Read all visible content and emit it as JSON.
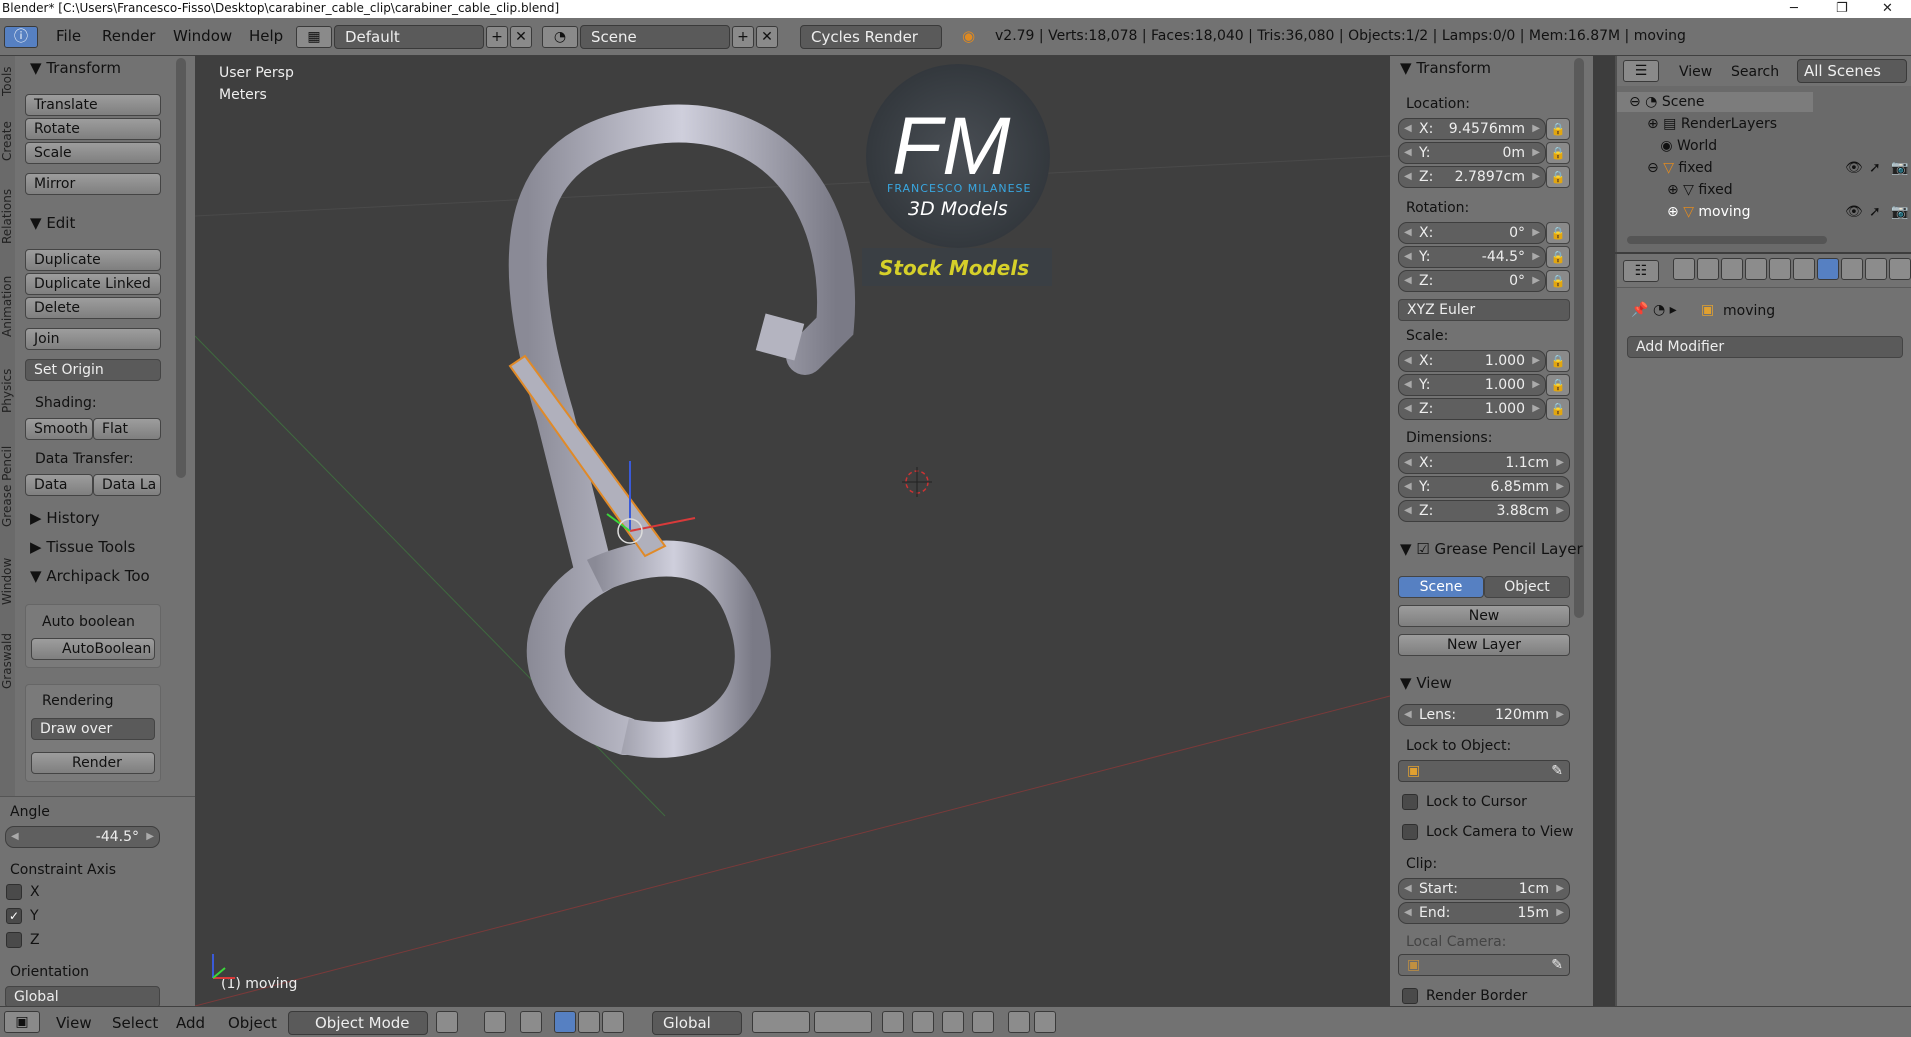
{
  "window": {
    "title": "Blender* [C:\\Users\\Francesco-Fisso\\Desktop\\carabiner_cable_clip\\carabiner_cable_clip.blend]"
  },
  "menubar": {
    "items": [
      "File",
      "Render",
      "Window",
      "Help"
    ],
    "screen_layout": "Default",
    "scene": "Scene",
    "render_engine": "Cycles Render",
    "stats": "v2.79 | Verts:18,078 | Faces:18,040 | Tris:36,080 | Objects:1/2 | Lamps:0/0 | Mem:16.87M | moving"
  },
  "tool_tabs": [
    "Tools",
    "Create",
    "Relations",
    "Animation",
    "Physics",
    "Grease Pencil",
    "Window",
    "Graswald"
  ],
  "tools": {
    "transform_title": "Transform",
    "translate": "Translate",
    "rotate": "Rotate",
    "scale": "Scale",
    "mirror": "Mirror",
    "edit_title": "Edit",
    "duplicate": "Duplicate",
    "duplicate_linked": "Duplicate Linked",
    "delete": "Delete",
    "join": "Join",
    "set_origin": "Set Origin",
    "shading_label": "Shading:",
    "smooth": "Smooth",
    "flat": "Flat",
    "data_transfer_label": "Data Transfer:",
    "data": "Data",
    "data_la": "Data La",
    "history": "History",
    "tissue": "Tissue Tools",
    "archipack": "Archipack Too",
    "auto_boolean_label": "Auto boolean",
    "autoboolean_btn": "AutoBoolean",
    "rendering_label": "Rendering",
    "draw_over": "Draw over",
    "render_btn": "Render"
  },
  "operator": {
    "angle_label": "Angle",
    "angle_value": "-44.5°",
    "constraint_label": "Constraint Axis",
    "x": "X",
    "y": "Y",
    "z": "Z",
    "y_checked": true,
    "orientation_label": "Orientation",
    "orientation_value": "Global"
  },
  "viewport": {
    "view_name": "User Persp",
    "units": "Meters",
    "object_label": "(1) moving",
    "logo_letters": "FM",
    "logo_name": "FRANCESCO MILANESE",
    "logo_sub": "3D Models",
    "logo_tag": "Stock Models"
  },
  "properties": {
    "transform_title": "Transform",
    "location_label": "Location:",
    "loc_x": "9.4576mm",
    "loc_y": "0m",
    "loc_z": "2.7897cm",
    "rotation_label": "Rotation:",
    "rot_x": "0°",
    "rot_y": "-44.5°",
    "rot_z": "0°",
    "rotation_mode": "XYZ Euler",
    "scale_label": "Scale:",
    "scl_x": "1.000",
    "scl_y": "1.000",
    "scl_z": "1.000",
    "dimensions_label": "Dimensions:",
    "dim_x": "1.1cm",
    "dim_y": "6.85mm",
    "dim_z": "3.88cm",
    "axis_x": "X:",
    "axis_y": "Y:",
    "axis_z": "Z:",
    "gp_title": "Grease Pencil Layer",
    "gp_scene": "Scene",
    "gp_object": "Object",
    "gp_new": "New",
    "gp_new_layer": "New Layer",
    "view_title": "View",
    "lens_label": "Lens:",
    "lens_value": "120mm",
    "lock_obj_label": "Lock to Object:",
    "lock_cursor": "Lock to Cursor",
    "lock_camera": "Lock Camera to View",
    "clip_label": "Clip:",
    "clip_start_label": "Start:",
    "clip_start": "1cm",
    "clip_end_label": "End:",
    "clip_end": "15m",
    "local_camera_label": "Local Camera:",
    "render_border": "Render Border"
  },
  "outliner": {
    "view": "View",
    "search": "Search",
    "filter": "All Scenes",
    "items": [
      "Scene",
      "RenderLayers",
      "World",
      "fixed",
      "fixed",
      "moving"
    ]
  },
  "modifiers": {
    "breadcrumb": "moving",
    "add_modifier": "Add Modifier"
  },
  "footer": {
    "view": "View",
    "select": "Select",
    "add": "Add",
    "object": "Object",
    "mode": "Object Mode",
    "orientation": "Global"
  }
}
